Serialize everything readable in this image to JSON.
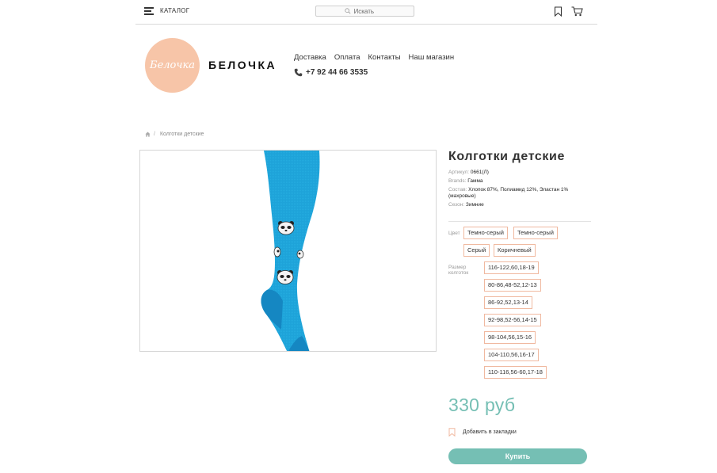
{
  "topbar": {
    "catalog_label": "КАТАЛОГ",
    "search_placeholder": "Искать",
    "icons": [
      "menu-icon",
      "search-icon",
      "bookmark-icon",
      "cart-icon"
    ]
  },
  "header": {
    "logo_text": "Белочка",
    "brand_name": "БЕЛОЧКА",
    "nav": [
      "Доставка",
      "Оплата",
      "Контакты",
      "Наш магазин"
    ],
    "phone": "+7 92 44 66 3535",
    "logo_color": "#f7c5a8"
  },
  "breadcrumb": {
    "sep": "/",
    "current": "Колготки детские"
  },
  "product": {
    "title": "Колготки детские",
    "specs": [
      {
        "key": "Артикул:",
        "value": "0661(Л)"
      },
      {
        "key": "Brands:",
        "value": "Гамма"
      },
      {
        "key": "Состав:",
        "value": "Хлопок 87%, Полиамид 12%, Эластан 1% (махровые)"
      },
      {
        "key": "Сезон:",
        "value": "Зимние"
      }
    ],
    "color_label": "Цвет",
    "colors": [
      "Темно-серый",
      "Темно-серый",
      "Серый",
      "Коричневый"
    ],
    "size_label": "Размер колготок",
    "sizes": [
      "116-122,60,18-19",
      "80-86,48-52,12-13",
      "86-92,52,13-14",
      "92-98,52-56,14-15",
      "98-104,56,15-16",
      "104-110,56,16-17",
      "110-116,56-60,17-18"
    ],
    "price": "330 руб",
    "wishlist_label": "Добавить в закладки",
    "buy_label": "Купить"
  },
  "colors": {
    "accent": "#75bfb4",
    "chip_border": "#f0b9a0",
    "tights": "#1ea3d9"
  }
}
